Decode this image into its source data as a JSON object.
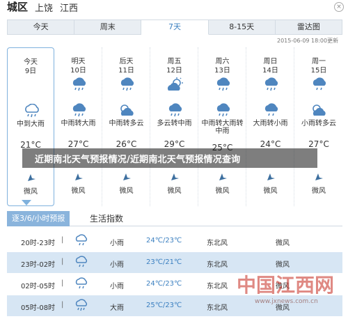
{
  "header": {
    "title": "城区",
    "city": "上饶",
    "province": "江西"
  },
  "tabs": [
    "今天",
    "周末",
    "7天",
    "8-15天",
    "雷达图"
  ],
  "active_tab": "7天",
  "updated": "2015-06-09 18:00更新",
  "days": [
    {
      "name": "今天",
      "date": "9日",
      "weather": "中到大雨",
      "high": "21°C",
      "wind": "微风",
      "icon": "rain-heavy",
      "today": true
    },
    {
      "name": "明天",
      "date": "10日",
      "weather": "中雨转大雨",
      "high": "27°C",
      "wind": "微风",
      "icon": "rain"
    },
    {
      "name": "后天",
      "date": "11日",
      "weather": "中雨转多云",
      "high": "26°C",
      "wind": "微风",
      "icon": "rain-cloud"
    },
    {
      "name": "周五",
      "date": "12日",
      "weather": "多云转中雨",
      "high": "29°C",
      "wind": "微风",
      "icon": "sun-cloud"
    },
    {
      "name": "周六",
      "date": "13日",
      "weather": "中雨转大雨转中雨",
      "high": "25°C",
      "wind": "微风",
      "icon": "rain"
    },
    {
      "name": "周日",
      "date": "14日",
      "weather": "大雨转小雨",
      "high": "24°C",
      "wind": "微风",
      "icon": "rain"
    },
    {
      "name": "周一",
      "date": "15日",
      "weather": "小雨转多云",
      "high": "27°C",
      "wind": "微风",
      "icon": "rain-cloud"
    }
  ],
  "banner": "近期南北天气预报情况/近期南北天气预报情况查询",
  "subtabs": {
    "hourly": "逐3/6/小时预报",
    "index": "生活指数"
  },
  "hourly": [
    {
      "time": "20时-23时",
      "sep": "|",
      "cond": "小雨",
      "temp": "24℃/23℃",
      "wdir": "东北风",
      "wlvl": "微风"
    },
    {
      "time": "23时-02时",
      "sep": "|",
      "cond": "小雨",
      "temp": "23℃/21℃",
      "wdir": "东北风",
      "wlvl": "微风"
    },
    {
      "time": "02时-05时",
      "sep": "|",
      "cond": "小雨",
      "temp": "24℃/23℃",
      "wdir": "东北风",
      "wlvl": "微风"
    },
    {
      "time": "05时-08时",
      "sep": "|",
      "cond": "大雨",
      "temp": "25℃/23℃",
      "wdir": "东北风",
      "wlvl": "微风"
    }
  ],
  "watermark": {
    "logo": "中国江西网",
    "url": "www.jxnews.com.cn"
  },
  "colors": {
    "accent": "#3a7fc0",
    "tab_bg": "#e9eef3",
    "row_alt": "#d7e6f4",
    "icon": "#4f86bf"
  }
}
